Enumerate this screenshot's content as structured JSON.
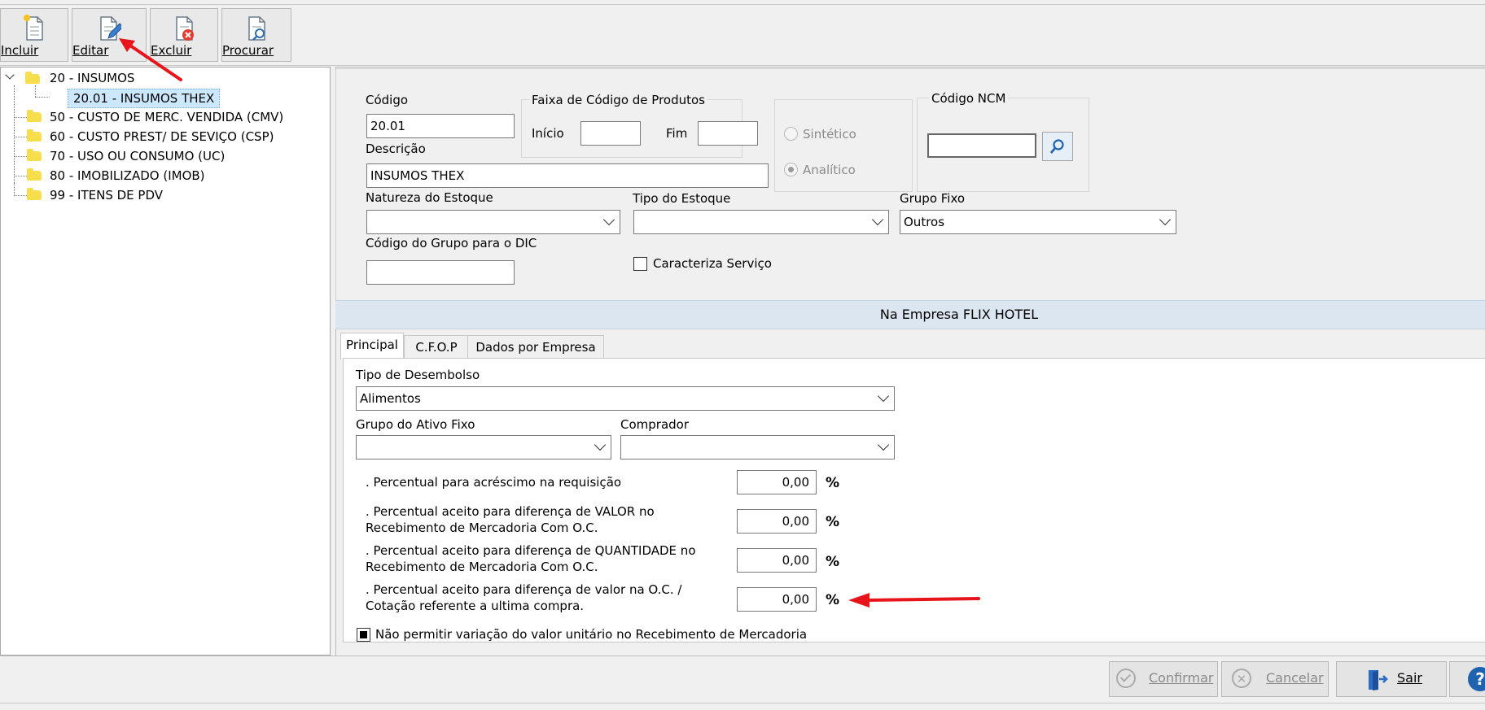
{
  "toolbar": {
    "incluir": "Incluir",
    "editar": "Editar",
    "excluir": "Excluir",
    "procurar": "Procurar"
  },
  "tree": {
    "items": [
      "20 - INSUMOS",
      "20.01 - INSUMOS THEX",
      "50 - CUSTO DE MERC. VENDIDA (CMV)",
      "60 - CUSTO PREST/ DE SEVIÇO (CSP)",
      "70 - USO OU CONSUMO (UC)",
      "80 - IMOBILIZADO (IMOB)",
      "99 - ITENS DE PDV"
    ]
  },
  "form": {
    "codigo_label": "Código",
    "codigo_value": "20.01",
    "faixa_label": "Faixa de Código de Produtos",
    "inicio_label": "Início",
    "fim_label": "Fim",
    "sintetico_label": "Sintético",
    "analitico_label": "Analítico",
    "ncm_label": "Código NCM",
    "descricao_label": "Descrição",
    "descricao_value": "INSUMOS THEX",
    "natureza_label": "Natureza do Estoque",
    "tipo_label": "Tipo do Estoque",
    "grupo_fixo_label": "Grupo Fixo",
    "grupo_fixo_value": "Outros",
    "dic_label": "Código do Grupo para o DIC",
    "caracteriza_label": "Caracteriza Serviço"
  },
  "company_header": "Na Empresa FLIX HOTEL",
  "tabs": [
    "Principal",
    "C.F.O.P",
    "Dados por Empresa"
  ],
  "principal": {
    "desembolso_label": "Tipo de Desembolso",
    "desembolso_value": "Alimentos",
    "ativo_label": "Grupo do Ativo Fixo",
    "comprador_label": "Comprador",
    "pct_symbol": "%",
    "rows": [
      {
        "line1": ". Percentual para acréscimo na requisição",
        "line2": "",
        "value": "0,00"
      },
      {
        "line1": ". Percentual aceito para diferença de VALOR no",
        "line2": "Recebimento de Mercadoria Com O.C.",
        "value": "0,00"
      },
      {
        "line1": ". Percentual aceito para diferença de QUANTIDADE no",
        "line2": "Recebimento de Mercadoria Com O.C.",
        "value": "0,00"
      },
      {
        "line1": ". Percentual aceito para diferença de valor na O.C. /",
        "line2": "Cotação referente a ultima compra.",
        "value": "0,00"
      }
    ],
    "nao_permitir": "Não permitir variação do valor unitário no Recebimento de Mercadoria"
  },
  "footer": {
    "confirmar": "Confirmar",
    "cancelar": "Cancelar",
    "sair": "Sair"
  },
  "colors": {
    "header_band": "#dce6f1",
    "selection": "#cce8ff",
    "annotation_arrow": "#e8141b"
  }
}
